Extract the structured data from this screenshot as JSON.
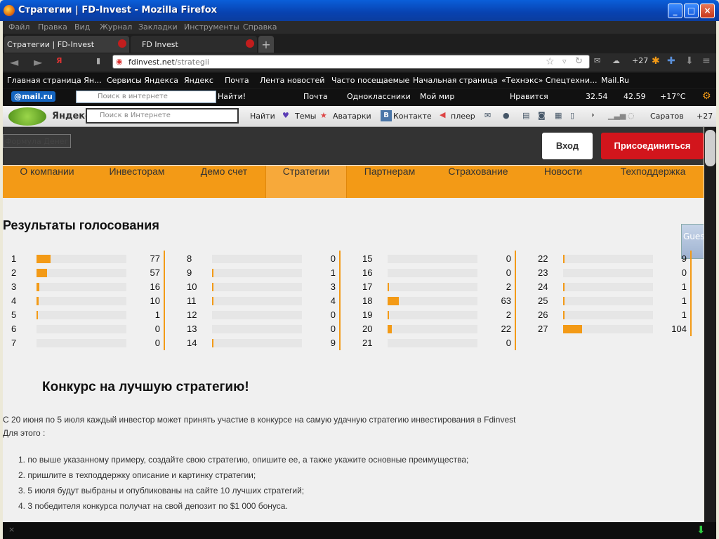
{
  "window": {
    "title": "Стратегии | FD-Invest - Mozilla Firefox"
  },
  "menu": [
    "Файл",
    "Правка",
    "Вид",
    "Журнал",
    "Закладки",
    "Инструменты",
    "Справка"
  ],
  "tabs": [
    {
      "label": "Стратегии | FD-Invest"
    },
    {
      "label": "FD Invest"
    }
  ],
  "url": {
    "host": "fdinvest.net",
    "path": "/strategii"
  },
  "toolbar_weather": "+27",
  "bookmarks": [
    "Главная страница Ян...",
    "Сервисы Яндекса",
    "Яндекс",
    "Почта",
    "Лента новостей",
    "Часто посещаемые",
    "Начальная страница",
    "«Технэкс» Спецтехни...",
    "Mail.Ru"
  ],
  "mailbar": {
    "logo": "@mail.ru",
    "search_placeholder": "Поиск в интернете",
    "find": "Найти!",
    "links": [
      "Почта",
      "Одноклассники",
      "Мой мир"
    ],
    "likes": "Нравится",
    "usd": "32.54",
    "eur": "42.59",
    "temp": "+17°C"
  },
  "yabar": {
    "logo": "Яндекс",
    "search_placeholder": "Поиск в Интернете",
    "find": "Найти",
    "links": [
      "Темы",
      "Аватарки",
      "Контакте",
      "плеер"
    ],
    "city": "Саратов",
    "city_temp": "+27"
  },
  "site": {
    "formula": "Формула Денег",
    "login": "Вход",
    "join": "Присоединиться",
    "nav": [
      "О компании",
      "Инвесторам",
      "Демо счет",
      "Стратегии",
      "Партнерам",
      "Страхование",
      "Новости",
      "Техподдержка"
    ],
    "results_title": "Результаты голосования",
    "guest": "Guest",
    "contest_title": "Конкурс на лучшую стратегию!",
    "contest_intro": "С 20 июня по 5 июля каждый инвестор может принять участие в конкурсе на самую удачную стратегию инвестирования в Fdinvest",
    "contest_for": "Для этого :",
    "contest_steps": [
      "1.  по выше указанному примеру, создайте свою стратегию, опишите ее, а также укажите основные преимущества;",
      "2.  пришлите в техподдержку описание и картинку стратегии;",
      "3.  5 июля будут выбраны и опубликованы на сайте 10 лучших стратегий;",
      "4.  3 победителя конкурса получат на свой депозит по $1 000 бонуса."
    ]
  },
  "votes": [
    {
      "n": "1",
      "v": "77"
    },
    {
      "n": "2",
      "v": "57"
    },
    {
      "n": "3",
      "v": "16"
    },
    {
      "n": "4",
      "v": "10"
    },
    {
      "n": "5",
      "v": "1"
    },
    {
      "n": "6",
      "v": "0"
    },
    {
      "n": "7",
      "v": "0"
    },
    {
      "n": "8",
      "v": "0"
    },
    {
      "n": "9",
      "v": "1"
    },
    {
      "n": "10",
      "v": "3"
    },
    {
      "n": "11",
      "v": "4"
    },
    {
      "n": "12",
      "v": "0"
    },
    {
      "n": "13",
      "v": "0"
    },
    {
      "n": "14",
      "v": "9"
    },
    {
      "n": "15",
      "v": "0"
    },
    {
      "n": "16",
      "v": "0"
    },
    {
      "n": "17",
      "v": "2"
    },
    {
      "n": "18",
      "v": "63"
    },
    {
      "n": "19",
      "v": "2"
    },
    {
      "n": "20",
      "v": "22"
    },
    {
      "n": "21",
      "v": "0"
    },
    {
      "n": "22",
      "v": "9"
    },
    {
      "n": "23",
      "v": "0"
    },
    {
      "n": "24",
      "v": "1"
    },
    {
      "n": "25",
      "v": "1"
    },
    {
      "n": "26",
      "v": "1"
    },
    {
      "n": "27",
      "v": "104"
    }
  ],
  "vote_bar_max": 500,
  "colors": {
    "accent": "#f39a16",
    "join": "#d2151c",
    "header": "#333333"
  }
}
